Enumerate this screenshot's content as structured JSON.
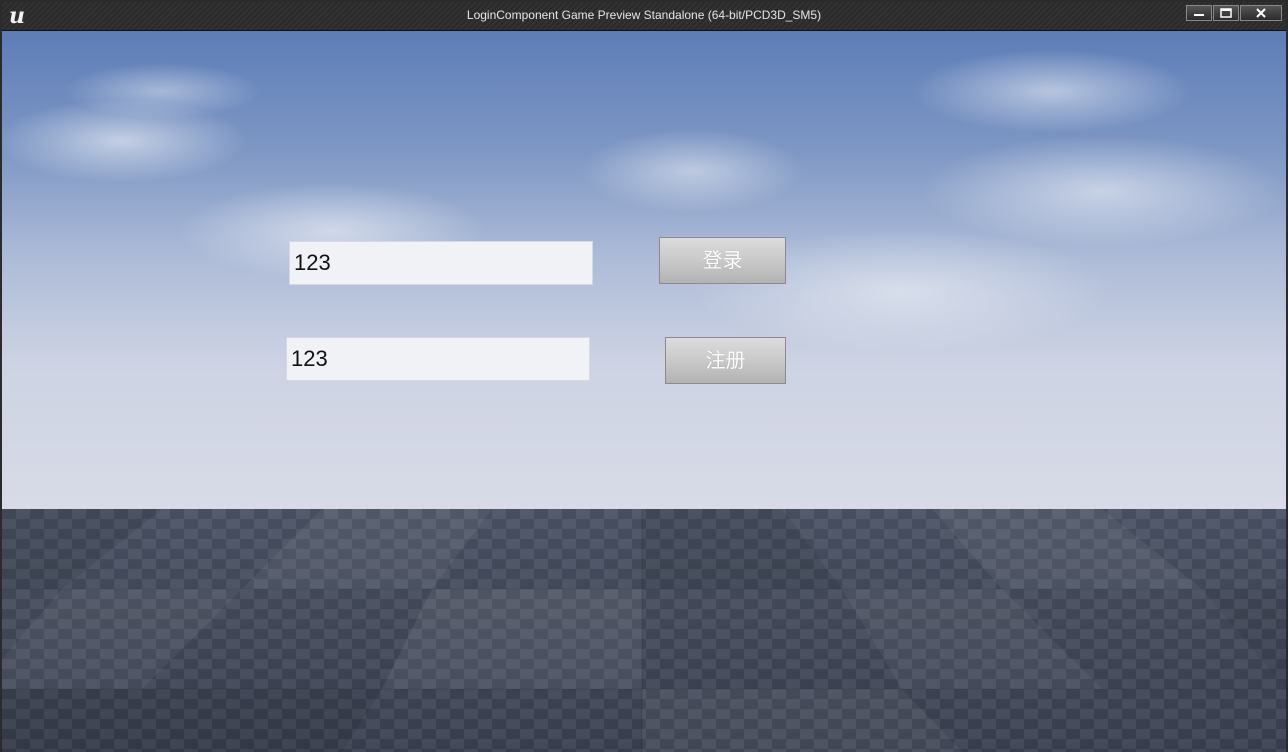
{
  "window": {
    "title": "LoginComponent Game Preview Standalone (64-bit/PCD3D_SM5)",
    "logo_icon": "unreal-engine-logo",
    "logo_glyph": "u",
    "controls": [
      "minimize-icon",
      "maximize-icon",
      "close-icon"
    ]
  },
  "form": {
    "username_value": "123",
    "password_value": "123",
    "login_label": "登录",
    "register_label": "注册"
  },
  "colors": {
    "input_bg": "#f1f2f6",
    "button_bg": "#c9c9c9",
    "button_text": "#ffffff",
    "sky_top": "#5d7db8",
    "floor": "#444b5c"
  }
}
